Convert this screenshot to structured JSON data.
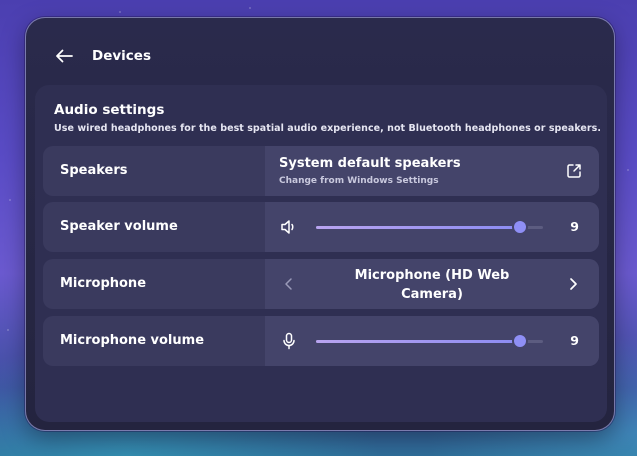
{
  "header": {
    "title": "Devices",
    "back_icon": "arrow-left-icon"
  },
  "section": {
    "title": "Audio settings",
    "subtitle": "Use wired headphones for the best spatial audio experience, not Bluetooth headphones or speakers."
  },
  "rows": {
    "speakers": {
      "label": "Speakers",
      "value": "System default speakers",
      "hint": "Change from Windows Settings",
      "icon": "external-link-icon"
    },
    "speaker_volume": {
      "label": "Speaker volume",
      "value": "9",
      "fraction": 0.9,
      "icon": "speaker-icon"
    },
    "microphone": {
      "label": "Microphone",
      "value": "Microphone (HD Web Camera)",
      "prev_icon": "chevron-left-icon",
      "next_icon": "chevron-right-icon"
    },
    "microphone_volume": {
      "label": "Microphone volume",
      "value": "9",
      "fraction": 0.9,
      "icon": "microphone-icon"
    }
  },
  "colors": {
    "accent": "#8f8ff5",
    "panel": "#2a2a4c",
    "row": "#3a3a5e",
    "control": "#44446a"
  }
}
